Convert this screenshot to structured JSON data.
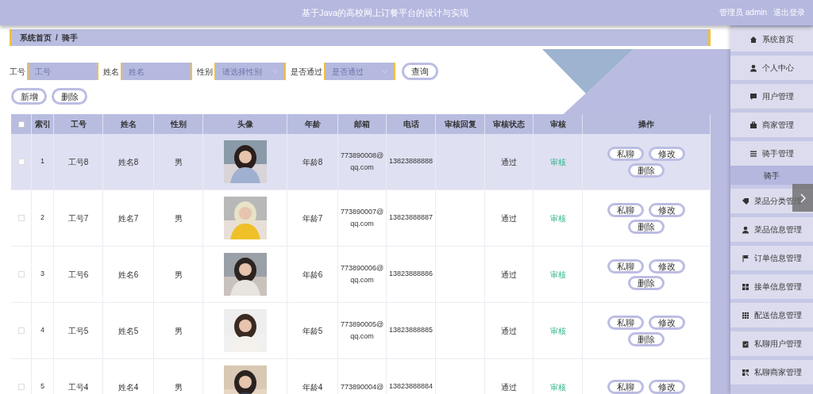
{
  "header": {
    "title": "基于Java的高校网上订餐平台的设计与实现",
    "user": "管理员 admin",
    "logout": "退出登录"
  },
  "breadcrumb": {
    "items": [
      "系统首页",
      "骑手"
    ],
    "separator": "/"
  },
  "search": {
    "fields": [
      {
        "kind": "input",
        "label": "工号",
        "placeholder": "工号"
      },
      {
        "kind": "input",
        "label": "姓名",
        "placeholder": "姓名"
      },
      {
        "kind": "select",
        "label": "性别",
        "placeholder": "请选择性别"
      },
      {
        "kind": "select",
        "label": "是否通过",
        "placeholder": "是否通过"
      }
    ],
    "button": "查询"
  },
  "actions": [
    "新增",
    "删除"
  ],
  "table": {
    "select_all": {
      "checked": false
    },
    "columns": [
      "索引",
      "工号",
      "姓名",
      "性别",
      "头像",
      "年龄",
      "邮箱",
      "电话",
      "审核回复",
      "审核状态",
      "审核",
      "操作"
    ],
    "rows": [
      {
        "checked": false,
        "highlighted": true,
        "index": "1",
        "job_no": "工号8",
        "name": "姓名8",
        "gender": "男",
        "avatar": {
          "kind": "picture"
        },
        "age": "年龄8",
        "email": "773890008@qq.com",
        "phone": "13823888888",
        "status": "通过",
        "review": "审核",
        "actions": [
          "私聊",
          "修改",
          "删除"
        ]
      },
      {
        "checked": false,
        "highlighted": false,
        "index": "2",
        "job_no": "工号7",
        "name": "姓名7",
        "gender": "男",
        "avatar": {
          "kind": "picture"
        },
        "age": "年龄7",
        "email": "773890007@qq.com",
        "phone": "13823888887",
        "status": "通过",
        "review": "审核",
        "actions": [
          "私聊",
          "修改",
          "删除"
        ]
      },
      {
        "checked": false,
        "highlighted": false,
        "index": "3",
        "job_no": "工号6",
        "name": "姓名6",
        "gender": "男",
        "avatar": {
          "kind": "picture"
        },
        "age": "年龄6",
        "email": "773890006@qq.com",
        "phone": "13823888886",
        "status": "通过",
        "review": "审核",
        "actions": [
          "私聊",
          "修改",
          "删除"
        ]
      },
      {
        "checked": false,
        "highlighted": false,
        "index": "4",
        "job_no": "工号5",
        "name": "姓名5",
        "gender": "男",
        "avatar": {
          "kind": "picture"
        },
        "age": "年龄5",
        "email": "773890005@qq.com",
        "phone": "13823888885",
        "status": "通过",
        "review": "审核",
        "actions": [
          "私聊",
          "修改",
          "删除"
        ]
      },
      {
        "checked": false,
        "highlighted": false,
        "index": "5",
        "job_no": "工号4",
        "name": "姓名4",
        "gender": "男",
        "avatar": {
          "kind": "picture"
        },
        "age": "年龄4",
        "email": "773890004@",
        "phone": "13823888884",
        "status": "通过",
        "review": "审核",
        "actions": [
          "私聊",
          "修改"
        ]
      }
    ]
  },
  "sidebar": {
    "items": [
      {
        "label": "系统首页"
      },
      {
        "label": "个人中心"
      },
      {
        "label": "用户管理"
      },
      {
        "label": "商家管理"
      },
      {
        "label": "骑手管理",
        "children": [
          {
            "label": "骑手",
            "selected": true
          }
        ]
      },
      {
        "label": "菜品分类管理"
      },
      {
        "label": "菜品信息管理"
      },
      {
        "label": "订单信息管理"
      },
      {
        "label": "接单信息管理"
      },
      {
        "label": "配送信息管理"
      },
      {
        "label": "私聊用户管理"
      },
      {
        "label": "私聊商家管理"
      }
    ]
  }
}
